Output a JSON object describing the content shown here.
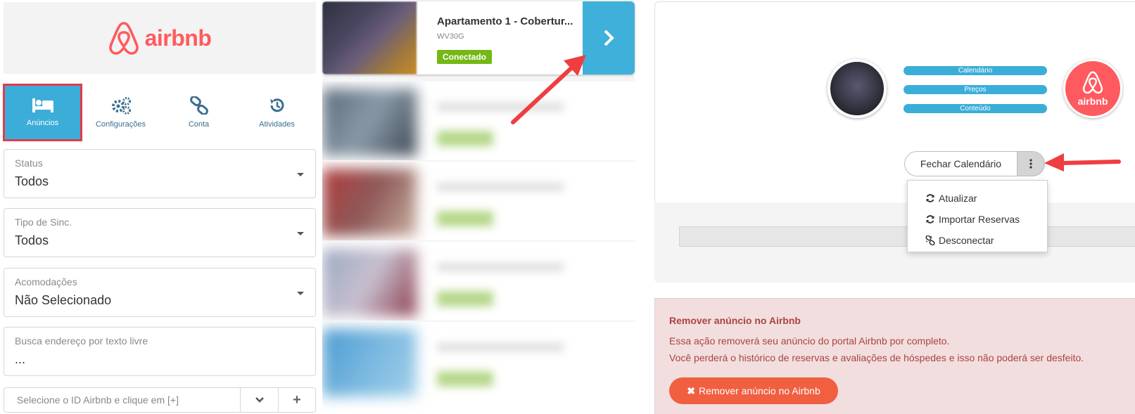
{
  "brand": {
    "logo_text": "airbnb",
    "color": "#ff5a5f"
  },
  "tabs": [
    {
      "label": "Anúncios",
      "icon": "bed-icon",
      "active": true
    },
    {
      "label": "Configurações",
      "icon": "gears-icon",
      "active": false
    },
    {
      "label": "Conta",
      "icon": "link-icon",
      "active": false
    },
    {
      "label": "Atividades",
      "icon": "history-icon",
      "active": false
    }
  ],
  "filters": {
    "status": {
      "label": "Status",
      "value": "Todos"
    },
    "sync_type": {
      "label": "Tipo de Sinc.",
      "value": "Todos"
    },
    "accommodations": {
      "label": "Acomodações",
      "value": "Não Selecionado"
    },
    "address_search": {
      "label": "Busca endereço por texto livre",
      "value": "..."
    }
  },
  "airbnb_id": {
    "placeholder": "Selecione o ID Airbnb e clique em [+]",
    "add_label": "+"
  },
  "listing": {
    "title": "Apartamento 1 - Cobertur...",
    "code": "WV30G",
    "status": "Conectado",
    "status_color": "#74b816"
  },
  "sync_pills": [
    "Calendário",
    "Preços",
    "Conteúdo"
  ],
  "airbnb_badge_label": "airbnb",
  "close_calendar_label": "Fechar Calendário",
  "dropdown_menu": [
    {
      "label": "Atualizar",
      "icon": "refresh-icon"
    },
    {
      "label": "Importar Reservas",
      "icon": "refresh-icon"
    },
    {
      "label": "Desconectar",
      "icon": "unlink-icon"
    }
  ],
  "remove_panel": {
    "title": "Remover anúncio no Airbnb",
    "line1": "Essa ação removerá seu anúncio do portal Airbnb por completo.",
    "line2": "Você perderá o histórico de reservas e avaliações de hóspedes e isso não poderá ser desfeito.",
    "button_icon": "✖",
    "button_label": "Remover anúncio no Airbnb"
  },
  "colors": {
    "accent_blue": "#3badd8",
    "highlight_red": "#e23c4a",
    "danger_text": "#a94442",
    "danger_bg": "#f2dede",
    "danger_button": "#f05f40"
  }
}
